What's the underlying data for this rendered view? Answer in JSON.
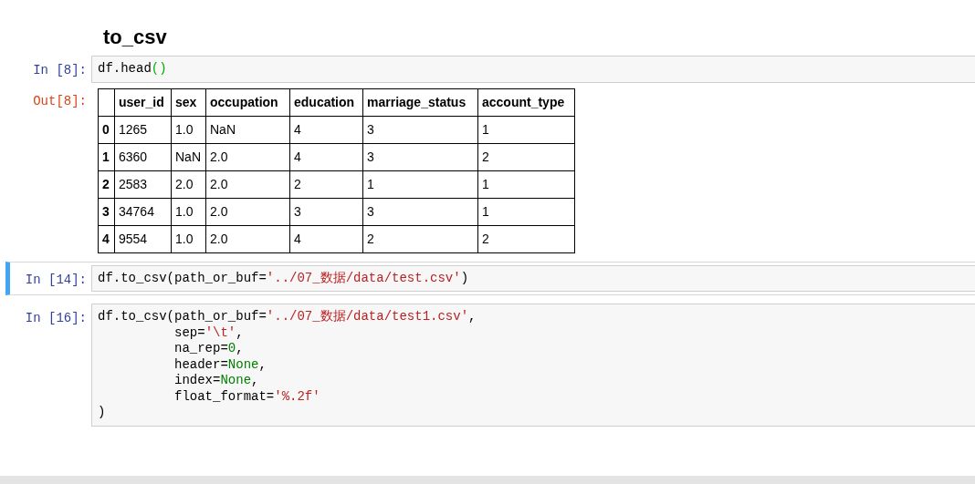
{
  "heading": "to_csv",
  "cells": [
    {
      "prompt": "In [8]:",
      "selected": false,
      "code": [
        [
          {
            "text": "df.head",
            "kind": "plain"
          },
          {
            "text": "()",
            "kind": "match"
          }
        ]
      ],
      "output": {
        "prompt": "Out[8]:",
        "table": {
          "columns": [
            "",
            "user_id",
            "sex",
            "occupation",
            "education",
            "marriage_status",
            "account_type"
          ],
          "rows": [
            [
              "0",
              "1265",
              "1.0",
              "NaN",
              "4",
              "3",
              "1"
            ],
            [
              "1",
              "6360",
              "NaN",
              "2.0",
              "4",
              "3",
              "2"
            ],
            [
              "2",
              "2583",
              "2.0",
              "2.0",
              "2",
              "1",
              "1"
            ],
            [
              "3",
              "34764",
              "1.0",
              "2.0",
              "3",
              "3",
              "1"
            ],
            [
              "4",
              "9554",
              "1.0",
              "2.0",
              "4",
              "2",
              "2"
            ]
          ]
        }
      }
    },
    {
      "prompt": "In [14]:",
      "selected": true,
      "code": [
        [
          {
            "text": "df.to_csv(path_or_buf=",
            "kind": "plain"
          },
          {
            "text": "'../07_数据/data/test.csv'",
            "kind": "string"
          },
          {
            "text": ")",
            "kind": "plain"
          }
        ]
      ]
    },
    {
      "prompt": "In [16]:",
      "selected": false,
      "code": [
        [
          {
            "text": "df.to_csv(path_or_buf=",
            "kind": "plain"
          },
          {
            "text": "'../07_数据/data/test1.csv'",
            "kind": "string"
          },
          {
            "text": ",",
            "kind": "plain"
          }
        ],
        [
          {
            "text": "          sep=",
            "kind": "plain"
          },
          {
            "text": "'\\t'",
            "kind": "string"
          },
          {
            "text": ",",
            "kind": "plain"
          }
        ],
        [
          {
            "text": "          na_rep=",
            "kind": "plain"
          },
          {
            "text": "0",
            "kind": "number"
          },
          {
            "text": ",",
            "kind": "plain"
          }
        ],
        [
          {
            "text": "          header=",
            "kind": "plain"
          },
          {
            "text": "None",
            "kind": "keyword"
          },
          {
            "text": ",",
            "kind": "plain"
          }
        ],
        [
          {
            "text": "          index=",
            "kind": "plain"
          },
          {
            "text": "None",
            "kind": "keyword"
          },
          {
            "text": ",",
            "kind": "plain"
          }
        ],
        [
          {
            "text": "          float_format=",
            "kind": "plain"
          },
          {
            "text": "'%.2f'",
            "kind": "string"
          }
        ],
        [
          {
            "text": ")",
            "kind": "plain"
          }
        ]
      ]
    }
  ]
}
